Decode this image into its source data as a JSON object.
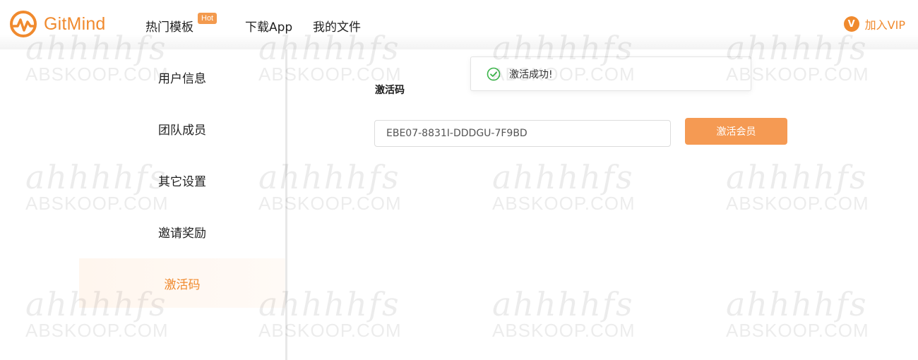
{
  "header": {
    "logo_text": "GitMind",
    "nav": [
      {
        "label": "热门模板",
        "badge": "Hot"
      },
      {
        "label": "下载App"
      },
      {
        "label": "我的文件"
      }
    ],
    "vip_icon_letter": "V",
    "vip_label": "加入VIP"
  },
  "sidebar": {
    "items": [
      {
        "label": "用户信息"
      },
      {
        "label": "团队成员"
      },
      {
        "label": "其它设置"
      },
      {
        "label": "邀请奖励"
      },
      {
        "label": "激活码",
        "active": true
      }
    ]
  },
  "main": {
    "section_label": "激活码",
    "code_value": "EBE07-8831I-DDDGU-7F9BD",
    "activate_button": "激活会员"
  },
  "toast": {
    "icon": "check-circle-icon",
    "message": "激活成功!"
  },
  "watermark": {
    "line1": "ahhhhfs",
    "line2": "ABSKOOP.COM"
  },
  "colors": {
    "brand": "#f08a2e",
    "button": "#f59a53",
    "success": "#3bb54a"
  }
}
